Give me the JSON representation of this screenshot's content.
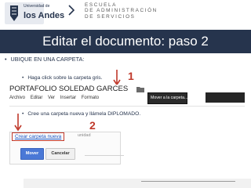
{
  "header": {
    "logo_top": "Universidad de",
    "logo_name": "los Andes",
    "school_lines": [
      "ESCUELA",
      "DE ADMINISTRACIÓN",
      "DE SERVICIOS"
    ]
  },
  "slide": {
    "title": "Editar el documento: paso 2",
    "bullet_main": "UBIQUE EN UNA CARPETA:",
    "bullet_sub1": "Haga click sobre la carpeta gris.",
    "bullet_sub2": "Cree una carpeta nueva y llámela DIPLOMADO.",
    "step1": "1",
    "step2": "2",
    "bullet_glyph": "•"
  },
  "drive": {
    "doc_title": "PORTAFOLIO SOLEDAD GARCES",
    "menus": [
      "Archivo",
      "Editar",
      "Ver",
      "Insertar",
      "Formato"
    ],
    "move_label": "Mover a la carpeta..."
  },
  "dialog": {
    "create_folder_link": "Crear carpeta nueva",
    "faded_text": "unidad",
    "move_button": "Mover",
    "cancel_button": "Cancelar"
  },
  "colors": {
    "navy": "#26344d",
    "accent_red": "#c0392b",
    "link_blue": "#1a55c4"
  }
}
